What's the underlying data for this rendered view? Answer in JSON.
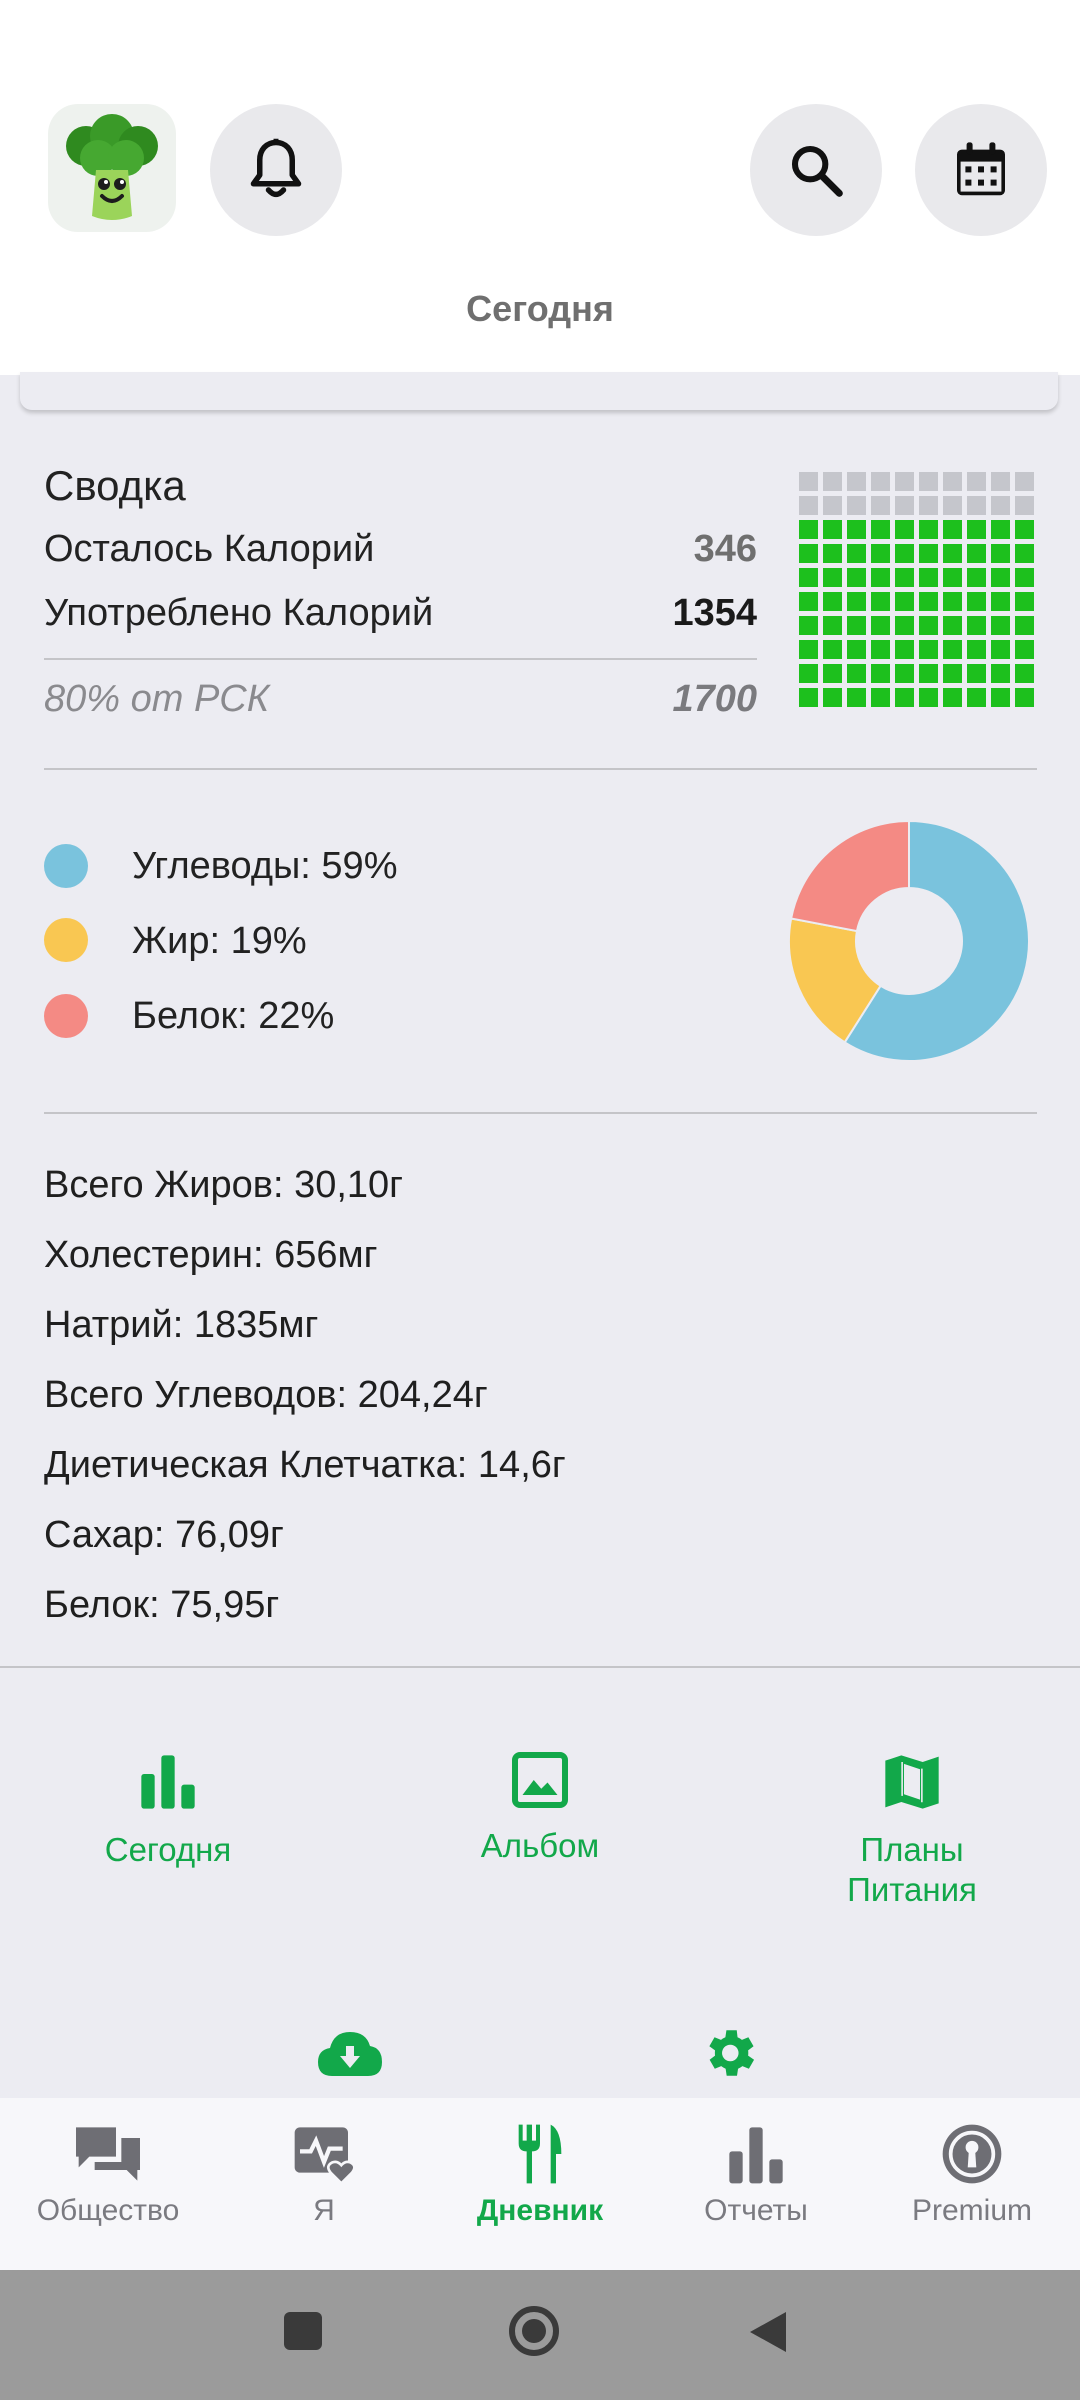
{
  "header": {
    "title": "Сегодня",
    "icons": [
      "broccoli-logo",
      "bell-icon",
      "search-icon",
      "calendar-icon"
    ]
  },
  "summary": {
    "heading": "Сводка",
    "remaining_label": "Осталось Калорий",
    "remaining_value": "346",
    "consumed_label": "Употреблено Калорий",
    "consumed_value": "1354",
    "rsk_label": "80% от РСК",
    "rsk_value": "1700",
    "grid_fill_fraction": 0.8
  },
  "macros": {
    "items": [
      {
        "label": "Углеводы: 59%",
        "value": 59,
        "color": "#7AC3DD"
      },
      {
        "label": "Жир: 19%",
        "value": 19,
        "color": "#F9C752"
      },
      {
        "label": "Белок: 22%",
        "value": 22,
        "color": "#F48A84"
      }
    ]
  },
  "nutrients": [
    "Всего Жиров: 30,10г",
    "Холестерин: 656мг",
    "Натрий: 1835мг",
    "Всего Углеводов: 204,24г",
    "Диетическая Клетчатка: 14,6г",
    "Сахар: 76,09г",
    "Белок: 75,95г"
  ],
  "actions": {
    "today": "Сегодня",
    "album": "Альбом",
    "plans_line1": "Планы",
    "plans_line2": "Питания"
  },
  "bottom_nav": {
    "community": "Общество",
    "me": "Я",
    "diary": "Дневник",
    "reports": "Отчеты",
    "premium": "Premium"
  },
  "colors": {
    "accent": "#12A84A",
    "grid_filled": "#1DC01D",
    "grid_empty": "#C5C6CC"
  }
}
